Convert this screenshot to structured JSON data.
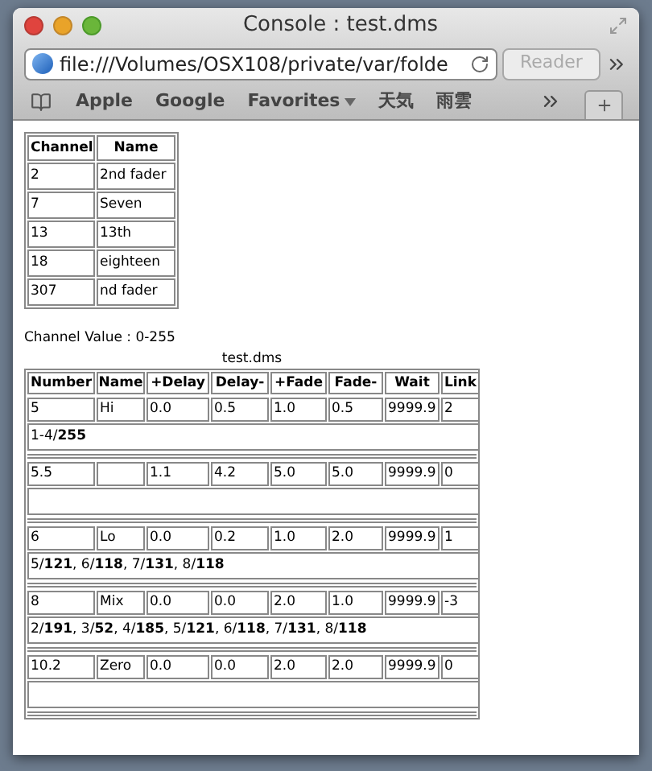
{
  "window": {
    "title": "Console : test.dms"
  },
  "address_bar": {
    "url": "file:///Volumes/OSX108/private/var/folde",
    "reader": "Reader"
  },
  "bookmarks": [
    "Apple",
    "Google",
    "Favorites",
    "天気",
    "雨雲"
  ],
  "channel_table": {
    "columns": [
      "Channel",
      "Name"
    ],
    "rows": [
      {
        "channel": "2",
        "name": "2nd fader"
      },
      {
        "channel": "7",
        "name": "Seven"
      },
      {
        "channel": "13",
        "name": "13th"
      },
      {
        "channel": "18",
        "name": "eighteen"
      },
      {
        "channel": "307",
        "name": "nd fader"
      }
    ]
  },
  "channel_value": "Channel Value : 0-255",
  "cue_table": {
    "caption": "test.dms",
    "columns": [
      "Number",
      "Name",
      "+Delay",
      "Delay-",
      "+Fade",
      "Fade-",
      "Wait",
      "Link"
    ],
    "rows": [
      {
        "cells": [
          "5",
          "Hi",
          "0.0",
          "0.5",
          "1.0",
          "0.5",
          "9999.9",
          "2"
        ],
        "detail": "1-4/**255**"
      },
      {
        "cells": [
          "5.5",
          "",
          "1.1",
          "4.2",
          "5.0",
          "5.0",
          "9999.9",
          "0"
        ]
      },
      {
        "cells": [
          "6",
          "Lo",
          "0.0",
          "0.2",
          "1.0",
          "2.0",
          "9999.9",
          "1"
        ],
        "detail": "5/**121**, 6/**118**, 7/**131**, 8/**118**"
      },
      {
        "cells": [
          "8",
          "Mix",
          "0.0",
          "0.0",
          "2.0",
          "1.0",
          "9999.9",
          "-3"
        ],
        "detail": "2/**191**, 3/**52**, 4/**185**, 5/**121**, 6/**118**, 7/**131**, 8/**118**"
      },
      {
        "cells": [
          "10.2",
          "Zero",
          "0.0",
          "0.0",
          "2.0",
          "2.0",
          "9999.9",
          "0"
        ]
      }
    ]
  }
}
